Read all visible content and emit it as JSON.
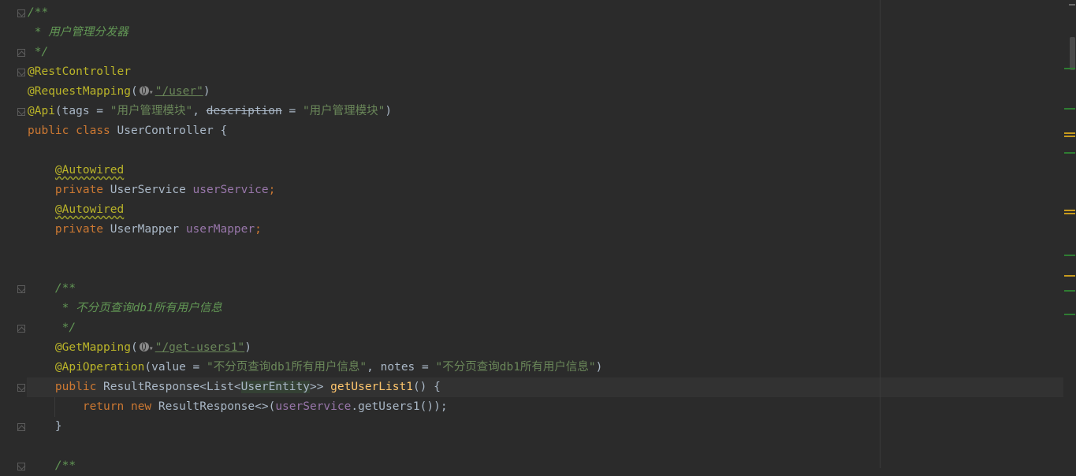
{
  "code": {
    "line1": "/**",
    "line2": " * 用户管理分发器",
    "line3": " */",
    "line4_ann": "@RestController",
    "line5_ann": "@RequestMapping",
    "line5_path": "\"/user\"",
    "line6_ann": "@Api",
    "line6_tags_key": "tags",
    "line6_tags_val": "\"用户管理模块\"",
    "line6_desc_key": "description",
    "line6_desc_val": "\"用户管理模块\"",
    "line7_public": "public",
    "line7_class": "class",
    "line7_name": "UserController {",
    "line9_ann": "@Autowired",
    "line10_private": "private",
    "line10_type": "UserService",
    "line10_field": "userService",
    "line11_ann": "@Autowired",
    "line12_private": "private",
    "line12_type": "UserMapper",
    "line12_field": "userMapper",
    "line15": "/**",
    "line16": " * 不分页查询db1所有用户信息",
    "line17": " */",
    "line18_ann": "@GetMapping",
    "line18_path": "\"/get-users1\"",
    "line19_ann": "@ApiOperation",
    "line19_value_key": "value",
    "line19_value_val": "\"不分页查询db1所有用户信息\"",
    "line19_notes_key": "notes",
    "line19_notes_val": "\"不分页查询db1所有用户信息\"",
    "line20_public": "public",
    "line20_type_pre": "ResultResponse<List<",
    "line20_type_entity": "UserEntity",
    "line20_type_post": ">>",
    "line20_method": "getUserList1",
    "line20_tail": "() {",
    "line21_return": "return",
    "line21_new": "new",
    "line21_type": "ResultResponse<>(",
    "line21_field": "userService",
    "line21_tail": ".getUsers1());",
    "line22": "}",
    "line24": "/**"
  },
  "colors": {
    "background": "#2b2b2b",
    "keyword": "#cc7832",
    "annotation": "#bbb529",
    "string": "#6a8759",
    "comment": "#629755",
    "field": "#9876aa",
    "method": "#ffc66d",
    "text": "#a9b7c6"
  },
  "icons": {
    "fold": "fold-marker-icon",
    "web": "globe-icon"
  }
}
